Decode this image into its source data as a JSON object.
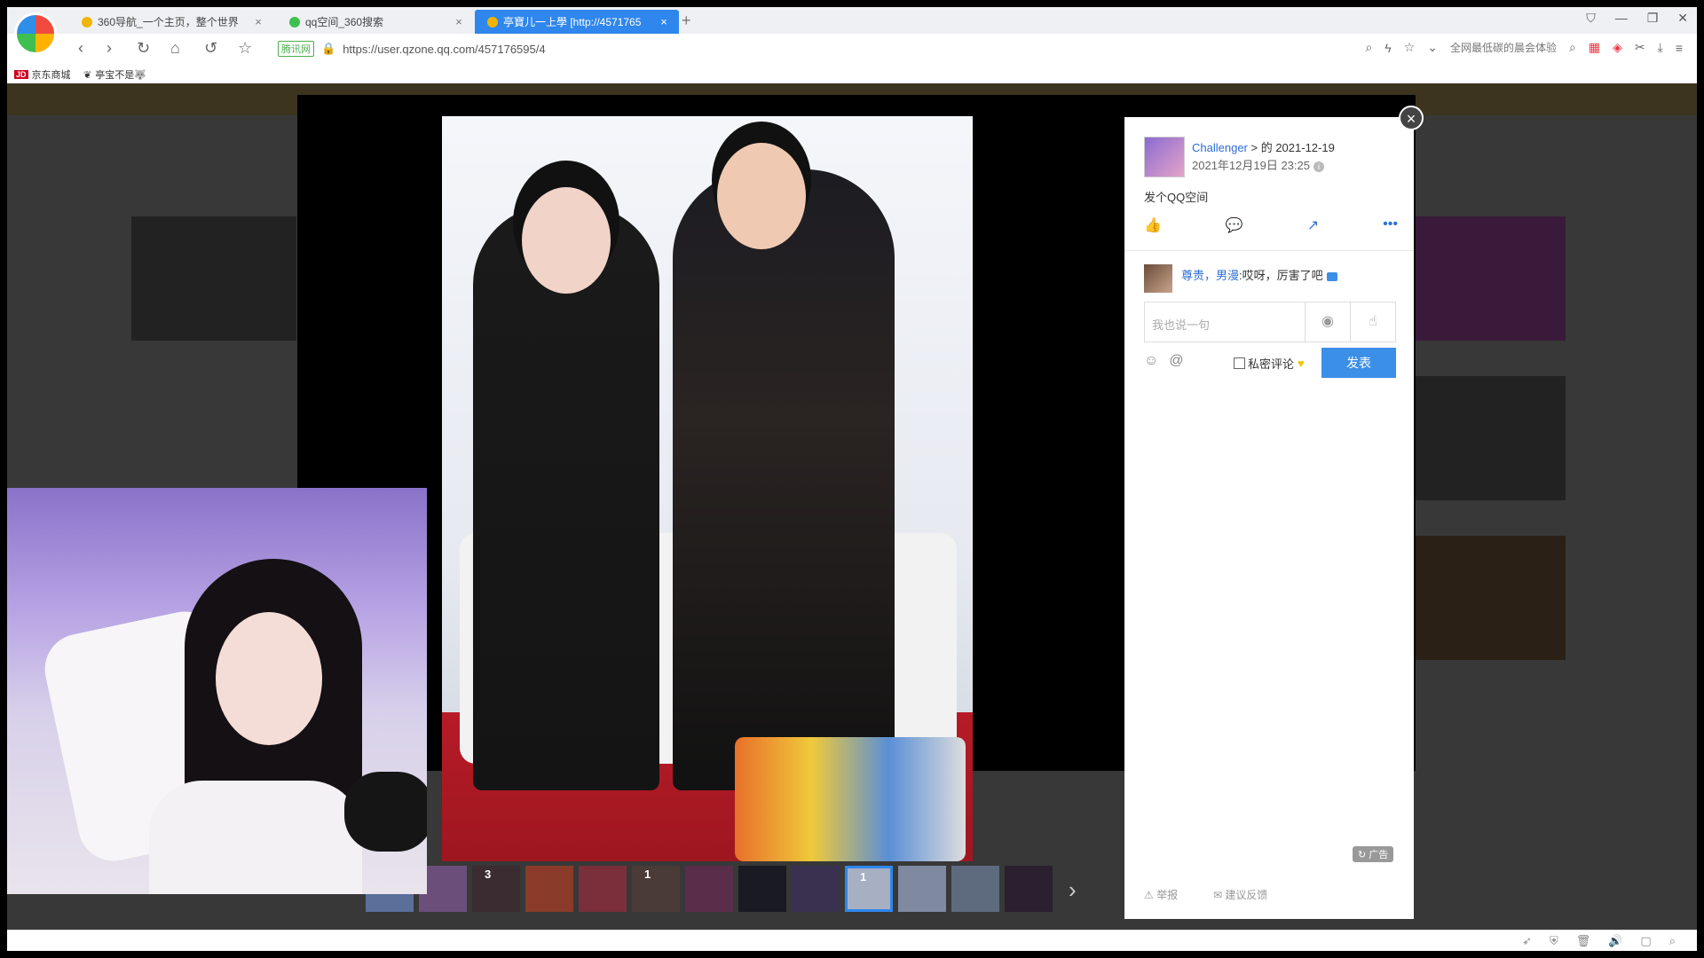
{
  "browser": {
    "tabs": [
      {
        "title": "360导航_一个主页，整个世界",
        "close": "×",
        "color": "#f3b400",
        "active": false
      },
      {
        "title": "qq空间_360搜索",
        "close": "×",
        "color": "#3fbf4f",
        "active": false
      },
      {
        "title": "亭寶儿一上學 [http://4571765",
        "close": "×",
        "color": "#f3b400",
        "active": true
      }
    ],
    "new_tab": "+",
    "url_badge": "腾讯网",
    "url": "https://user.qzone.qq.com/457176595/4",
    "promo": "全网最低碳的晨会体验",
    "bookmarks": [
      {
        "label": "京东商城",
        "badge": "JD"
      },
      {
        "label": "亭宝不是🐺"
      }
    ]
  },
  "photo_panel": {
    "poster_name": "Challenger",
    "poster_suffix": "> 的 2021-12-19",
    "post_time": "2021年12月19日 23:25",
    "info_icon": "i",
    "description": "发个QQ空间",
    "actions": [
      "like-icon",
      "comment-icon",
      "share-icon",
      "more-icon"
    ],
    "comment": {
      "author": "尊贵，男漫",
      "text": ":哎呀，厉害了吧"
    },
    "input_placeholder": "我也说一句",
    "private_label": "私密评论",
    "send_label": "发表",
    "ad_label": "广告",
    "report_label": "举报",
    "feedback_label": "建议反馈",
    "close_symbol": "×"
  },
  "filmstrip": {
    "thumbs": [
      {
        "badge": "",
        "selected": false,
        "color": "#5a6f9a"
      },
      {
        "badge": "",
        "selected": false,
        "color": "#6b4e7a"
      },
      {
        "badge": "3",
        "selected": false,
        "color": "#3a2c30"
      },
      {
        "badge": "",
        "selected": false,
        "color": "#8a3b2a"
      },
      {
        "badge": "",
        "selected": false,
        "color": "#7a2f3a"
      },
      {
        "badge": "1",
        "selected": false,
        "color": "#4a3b36"
      },
      {
        "badge": "",
        "selected": false,
        "color": "#5a2d4a"
      },
      {
        "badge": "",
        "selected": false,
        "color": "#1a1a22"
      },
      {
        "badge": "",
        "selected": false,
        "color": "#3a3050"
      },
      {
        "badge": "1",
        "selected": true,
        "color": "#a6b0c2"
      },
      {
        "badge": "",
        "selected": false,
        "color": "#7f8aa0"
      },
      {
        "badge": "",
        "selected": false,
        "color": "#5e6a7e"
      },
      {
        "badge": "",
        "selected": false,
        "color": "#2a2030"
      }
    ],
    "next": "›"
  },
  "colors": {
    "accent": "#2f86ec",
    "send_button": "#3c8fe6",
    "link": "#2c6dd6"
  }
}
